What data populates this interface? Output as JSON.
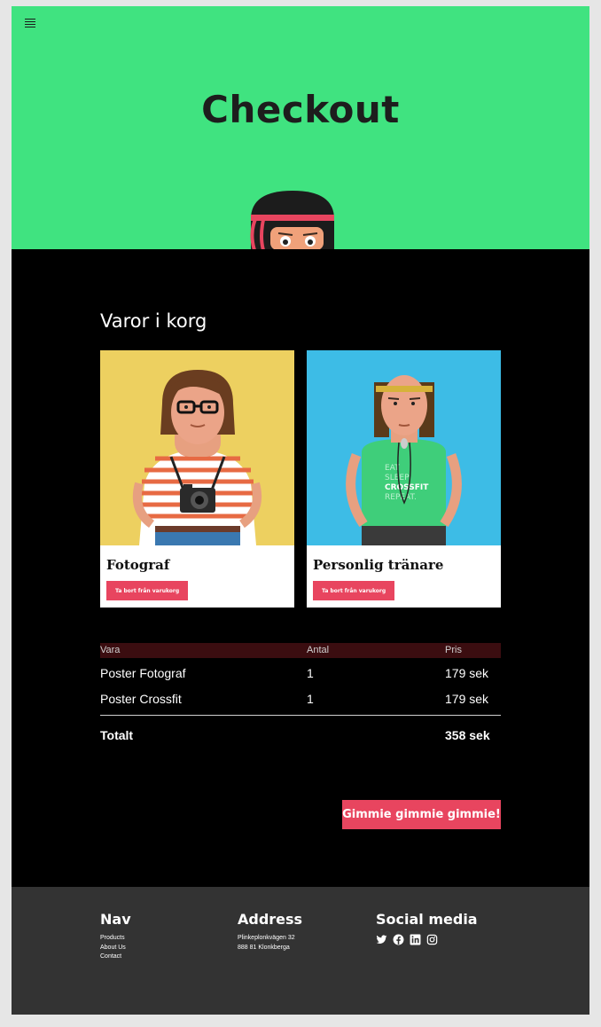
{
  "hero": {
    "title": "Checkout"
  },
  "cart": {
    "heading": "Varor i korg",
    "products": [
      {
        "name": "Fotograf",
        "button": "Ta bort från varukorg",
        "bg": "#edd060"
      },
      {
        "name": "Personlig tränare",
        "button": "Ta bort från varukorg",
        "bg": "#3dbce6"
      }
    ]
  },
  "table": {
    "headers": [
      "Vara",
      "Antal",
      "Pris"
    ],
    "rows": [
      {
        "item": "Poster Fotograf",
        "qty": "1",
        "price": "179 sek"
      },
      {
        "item": "Poster Crossfit",
        "qty": "1",
        "price": "179 sek"
      }
    ],
    "total_label": "Totalt",
    "total_value": "358 sek"
  },
  "checkout_button": "Gimmie gimmie gimmie!",
  "footer": {
    "nav": {
      "title": "Nav",
      "links": [
        "Products",
        "About Us",
        "Contact"
      ]
    },
    "address": {
      "title": "Address",
      "lines": [
        "Plinkeplonkvägen 32",
        "888 81 Klonkberga"
      ]
    },
    "social": {
      "title": "Social media",
      "icons": [
        "twitter-icon",
        "facebook-icon",
        "linkedin-icon",
        "instagram-icon"
      ]
    }
  },
  "colors": {
    "accent": "#e8455f",
    "hero_bg": "#40e380",
    "footer_bg": "#333333"
  }
}
